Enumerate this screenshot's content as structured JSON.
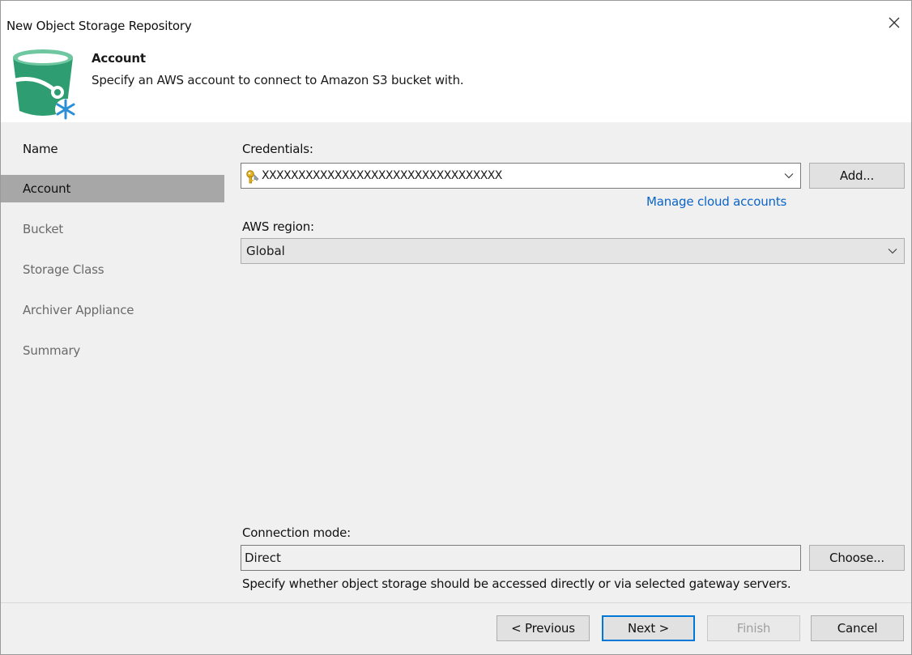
{
  "window": {
    "title": "New Object Storage Repository"
  },
  "header": {
    "title": "Account",
    "subtitle": "Specify an AWS account to connect to Amazon S3 bucket with."
  },
  "steps": [
    {
      "label": "Name",
      "state": "done"
    },
    {
      "label": "Account",
      "state": "active"
    },
    {
      "label": "Bucket",
      "state": "todo"
    },
    {
      "label": "Storage Class",
      "state": "todo"
    },
    {
      "label": "Archiver Appliance",
      "state": "todo"
    },
    {
      "label": "Summary",
      "state": "todo"
    }
  ],
  "credentials": {
    "label": "Credentials:",
    "value": "XXXXXXXXXXXXXXXXXXXXXXXXXXXXXXXXX",
    "add_label": "Add...",
    "manage_link": "Manage cloud accounts"
  },
  "region": {
    "label": "AWS region:",
    "value": "Global"
  },
  "connection": {
    "label": "Connection mode:",
    "value": "Direct",
    "choose_label": "Choose...",
    "hint": "Specify whether object storage should be accessed directly or via selected gateway servers."
  },
  "footer": {
    "previous_label": "< Previous",
    "next_label": "Next >",
    "finish_label": "Finish",
    "cancel_label": "Cancel"
  },
  "colors": {
    "accent": "#0078d7",
    "link": "#0a64c8",
    "bucket_green": "#2e9e72",
    "snowflake_blue": "#2c8fd6",
    "active_step_bg": "#a7a7a7"
  },
  "icons": {
    "close": "close-icon",
    "wizard": "bucket-snowflake-icon",
    "credentials": "key-icon",
    "dropdown": "chevron-down-icon"
  }
}
